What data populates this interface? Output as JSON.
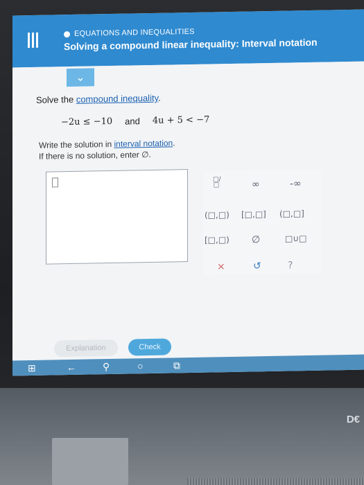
{
  "header": {
    "topic": "EQUATIONS AND INEQUALITIES",
    "title": "Solving a compound linear inequality: Interval notation"
  },
  "problem": {
    "prompt_prefix": "Solve the ",
    "prompt_link": "compound inequality",
    "prompt_suffix": ".",
    "left_ineq": "−2u ≤ −10",
    "and": "and",
    "right_ineq": "4u + 5 < −7",
    "instr_prefix": "Write the solution in ",
    "instr_link": "interval notation",
    "instr_suffix": ".",
    "no_solution_text": "If there is no solution, enter ∅."
  },
  "keypad": {
    "keys": {
      "fraction": "□/□",
      "infinity": "∞",
      "neg_infinity": "-∞",
      "open_open": "(□,□)",
      "closed_closed": "[□,□]",
      "open_closed": "(□,□]",
      "closed_open": "[□,□)",
      "empty_set": "∅",
      "union": "□∪□",
      "clear": "×",
      "undo": "↺",
      "help": "?"
    }
  },
  "buttons": {
    "explanation": "Explanation",
    "check": "Check"
  },
  "laptop": {
    "brand_partial": "D€"
  },
  "colors": {
    "header_blue": "#2f8ad0",
    "check_blue": "#4fa8dc",
    "link_blue": "#1a5fb0"
  }
}
